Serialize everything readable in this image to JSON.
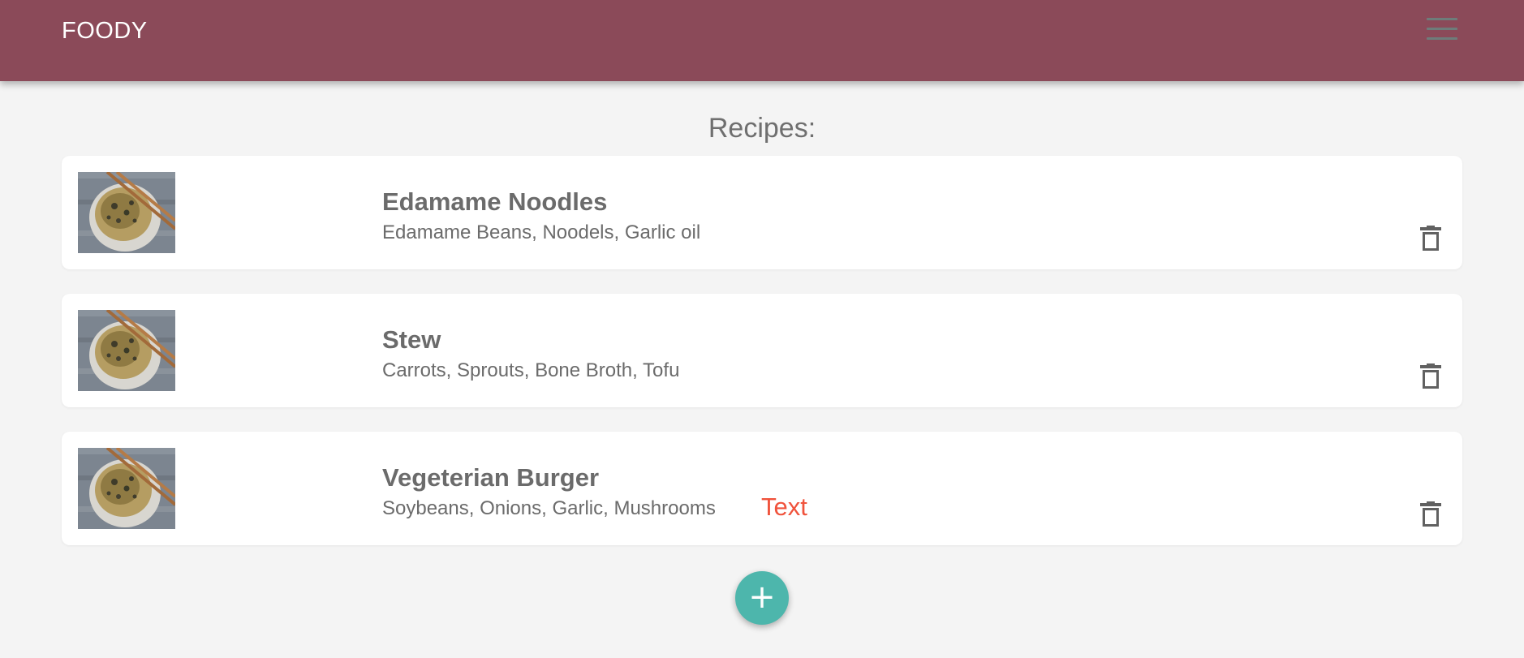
{
  "app": {
    "brand": "FOODY",
    "menu_icon": "hamburger-menu-icon",
    "colors": {
      "navbar": "#8b4a59",
      "background": "#f4f4f4",
      "fab": "#4db6ac",
      "highlight_text": "#f0533c"
    }
  },
  "main": {
    "title": "Recipes:",
    "recipes": [
      {
        "name": "Edamame Noodles",
        "ingredients": "Edamame Beans, Noodels, Garlic oil",
        "extra": "",
        "image_icon": "noodle-bowl-image",
        "delete_icon": "trash-icon"
      },
      {
        "name": "Stew",
        "ingredients": "Carrots, Sprouts, Bone Broth, Tofu",
        "extra": "",
        "image_icon": "noodle-bowl-image",
        "delete_icon": "trash-icon"
      },
      {
        "name": "Vegeterian Burger",
        "ingredients": "Soybeans, Onions, Garlic, Mushrooms",
        "extra": "Text",
        "image_icon": "noodle-bowl-image",
        "delete_icon": "trash-icon"
      }
    ],
    "add_button": {
      "label": "+",
      "icon": "plus-icon"
    }
  }
}
